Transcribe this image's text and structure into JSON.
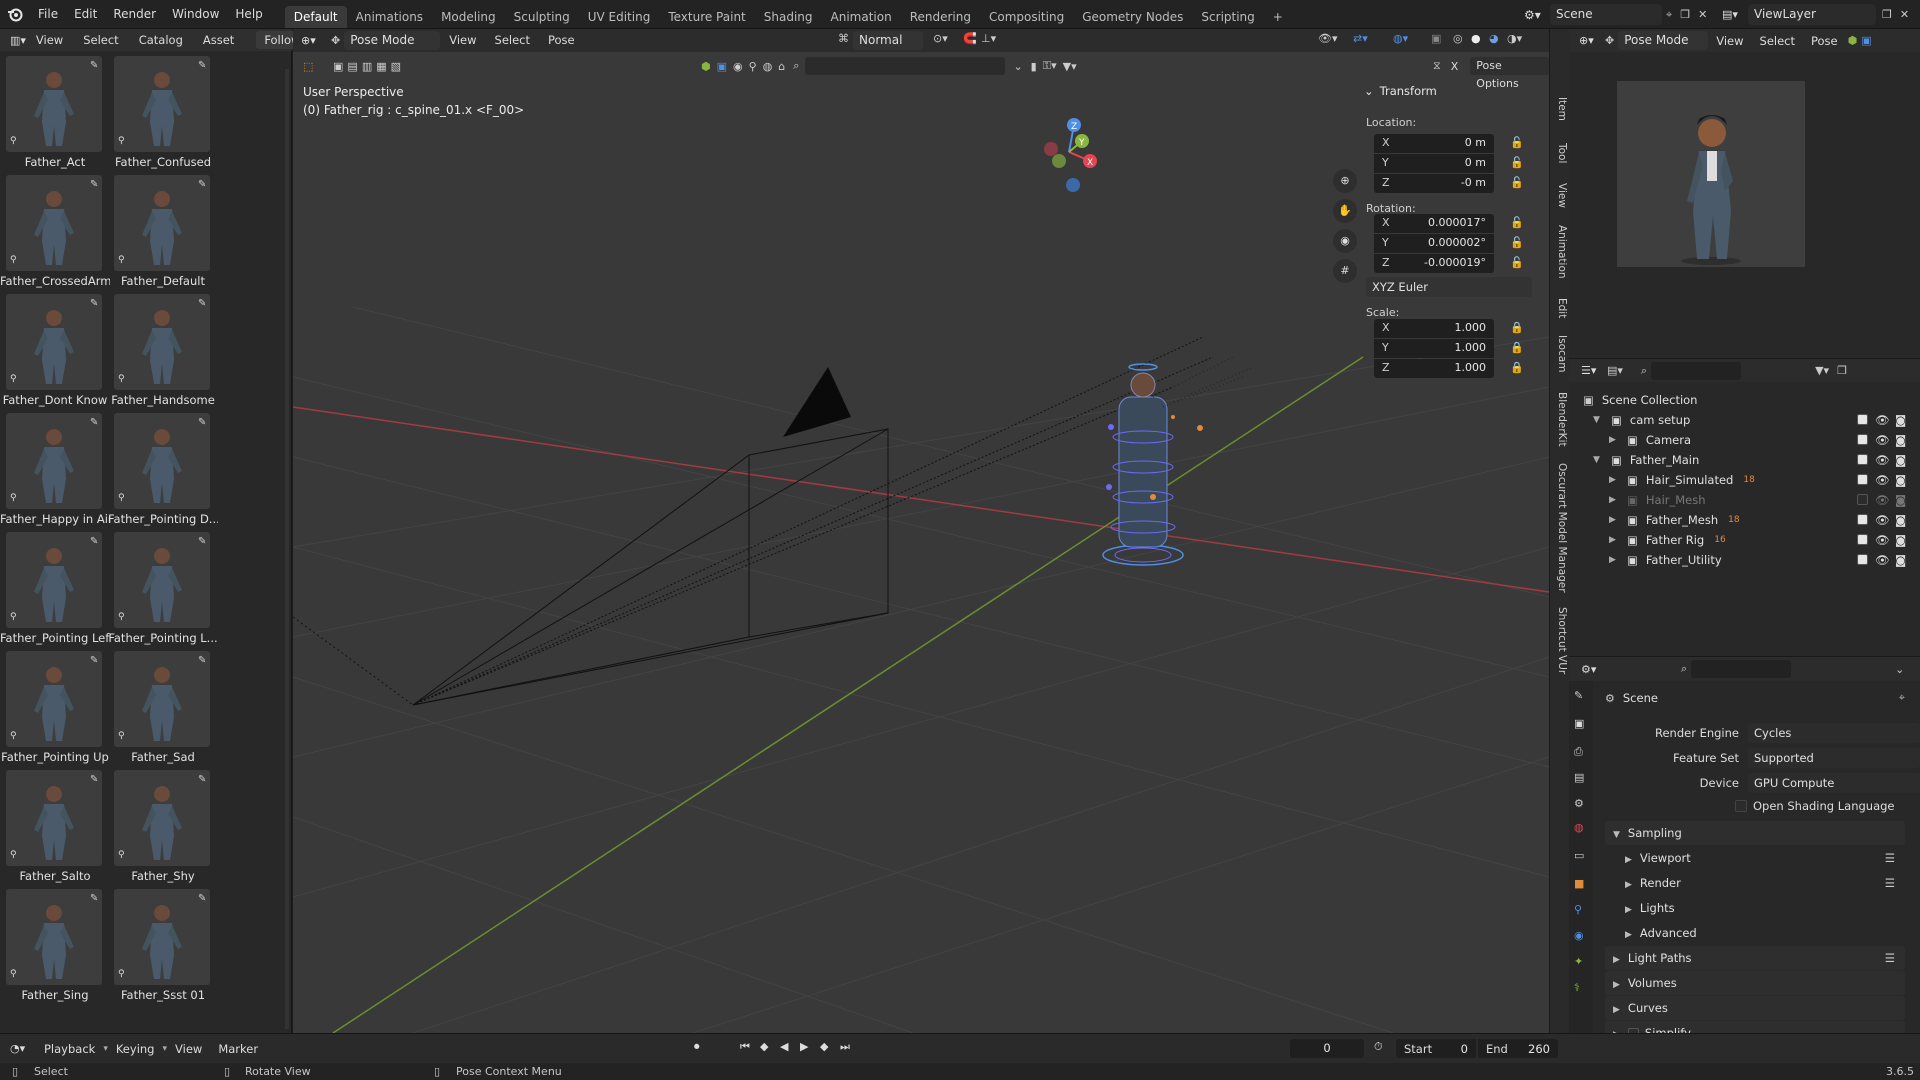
{
  "topbar": {
    "menus": [
      "File",
      "Edit",
      "Render",
      "Window",
      "Help"
    ],
    "workspaces": [
      "Default",
      "Animations",
      "Modeling",
      "Sculpting",
      "UV Editing",
      "Texture Paint",
      "Shading",
      "Animation",
      "Rendering",
      "Compositing",
      "Geometry Nodes",
      "Scripting"
    ],
    "active_workspace": "Default",
    "add_tab": "+",
    "scene_name": "Scene",
    "view_layer": "ViewLayer"
  },
  "asset_browser": {
    "header": [
      "View",
      "Select",
      "Catalog",
      "Asset"
    ],
    "follow": "Follow",
    "assets": [
      {
        "name": "Father_Act"
      },
      {
        "name": "Father_Confused"
      },
      {
        "name": "Father_CrossedArm"
      },
      {
        "name": "Father_Default"
      },
      {
        "name": "Father_Dont Know"
      },
      {
        "name": "Father_Handsome"
      },
      {
        "name": "Father_Happy in Air"
      },
      {
        "name": "Father_Pointing D..."
      },
      {
        "name": "Father_Pointing Left"
      },
      {
        "name": "Father_Pointing L..."
      },
      {
        "name": "Father_Pointing Up"
      },
      {
        "name": "Father_Sad"
      },
      {
        "name": "Father_Salto"
      },
      {
        "name": "Father_Shy"
      },
      {
        "name": "Father_Sing"
      },
      {
        "name": "Father_Ssst 01"
      }
    ]
  },
  "viewport": {
    "mode": "Pose Mode",
    "menus": [
      "View",
      "Select",
      "Pose"
    ],
    "orientation": "Normal",
    "perspective_label": "User Perspective",
    "active_bone": "(0) Father_rig : c_spine_01.x <F_00>",
    "pose_options": "Pose Options",
    "x_mirror": "X"
  },
  "transform_panel": {
    "title": "Transform",
    "location_label": "Location:",
    "location": {
      "x": "0 m",
      "y": "0 m",
      "z": "-0 m"
    },
    "rotation_label": "Rotation:",
    "rotation": {
      "x": "0.000017°",
      "y": "0.000002°",
      "z": "-0.000019°"
    },
    "rotation_mode": "XYZ Euler",
    "scale_label": "Scale:",
    "scale": {
      "x": "1.000",
      "y": "1.000",
      "z": "1.000"
    },
    "axes": [
      "X",
      "Y",
      "Z"
    ]
  },
  "npanel_tabs": [
    "Item",
    "Tool",
    "View",
    "Animation",
    "Edit",
    "Isocam",
    "BlenderKit",
    "Oscurart Model Manager",
    "Shortcut VUr"
  ],
  "preview_header": {
    "mode": "Pose Mode",
    "menus": [
      "View",
      "Select",
      "Pose"
    ]
  },
  "outliner": {
    "root": "Scene Collection",
    "rows": [
      {
        "name": "cam setup",
        "indent": 1,
        "expanded": true,
        "dim": false
      },
      {
        "name": "Camera",
        "indent": 2,
        "expanded": false,
        "dim": false
      },
      {
        "name": "Father_Main",
        "indent": 1,
        "expanded": true,
        "dim": false
      },
      {
        "name": "Hair_Simulated",
        "indent": 2,
        "expanded": false,
        "dim": false,
        "count": "18"
      },
      {
        "name": "Hair_Mesh",
        "indent": 2,
        "expanded": false,
        "dim": true
      },
      {
        "name": "Father_Mesh",
        "indent": 2,
        "expanded": false,
        "dim": false,
        "count": "18"
      },
      {
        "name": "Father Rig",
        "indent": 2,
        "expanded": false,
        "dim": false,
        "count": "16"
      },
      {
        "name": "Father_Utility",
        "indent": 2,
        "expanded": false,
        "dim": false
      }
    ]
  },
  "properties": {
    "scene_label": "Scene",
    "render_engine_label": "Render Engine",
    "render_engine": "Cycles",
    "feature_set_label": "Feature Set",
    "feature_set": "Supported",
    "device_label": "Device",
    "device": "GPU Compute",
    "osl_label": "Open Shading Language",
    "sections": [
      {
        "name": "Sampling",
        "expanded": true,
        "level": 0
      },
      {
        "name": "Viewport",
        "expanded": false,
        "level": 1
      },
      {
        "name": "Render",
        "expanded": false,
        "level": 1
      },
      {
        "name": "Lights",
        "expanded": false,
        "level": 1
      },
      {
        "name": "Advanced",
        "expanded": false,
        "level": 1
      },
      {
        "name": "Light Paths",
        "expanded": false,
        "level": 0
      },
      {
        "name": "Volumes",
        "expanded": false,
        "level": 0
      },
      {
        "name": "Curves",
        "expanded": false,
        "level": 0
      },
      {
        "name": "Simplify",
        "expanded": false,
        "level": 0
      }
    ]
  },
  "timeline": {
    "menus": [
      "Playback",
      "Keying",
      "View",
      "Marker"
    ],
    "current_frame": "0",
    "start_label": "Start",
    "start": "0",
    "end_label": "End",
    "end": "260"
  },
  "statusbar": {
    "select": "Select",
    "rotate": "Rotate View",
    "context": "Pose Context Menu",
    "version": "3.6.5"
  },
  "colors": {
    "accent": "#4772b3",
    "x_axis": "#e44552",
    "y_axis": "#8ab640",
    "z_axis": "#4f8fe6",
    "orange": "#e08a3c"
  }
}
